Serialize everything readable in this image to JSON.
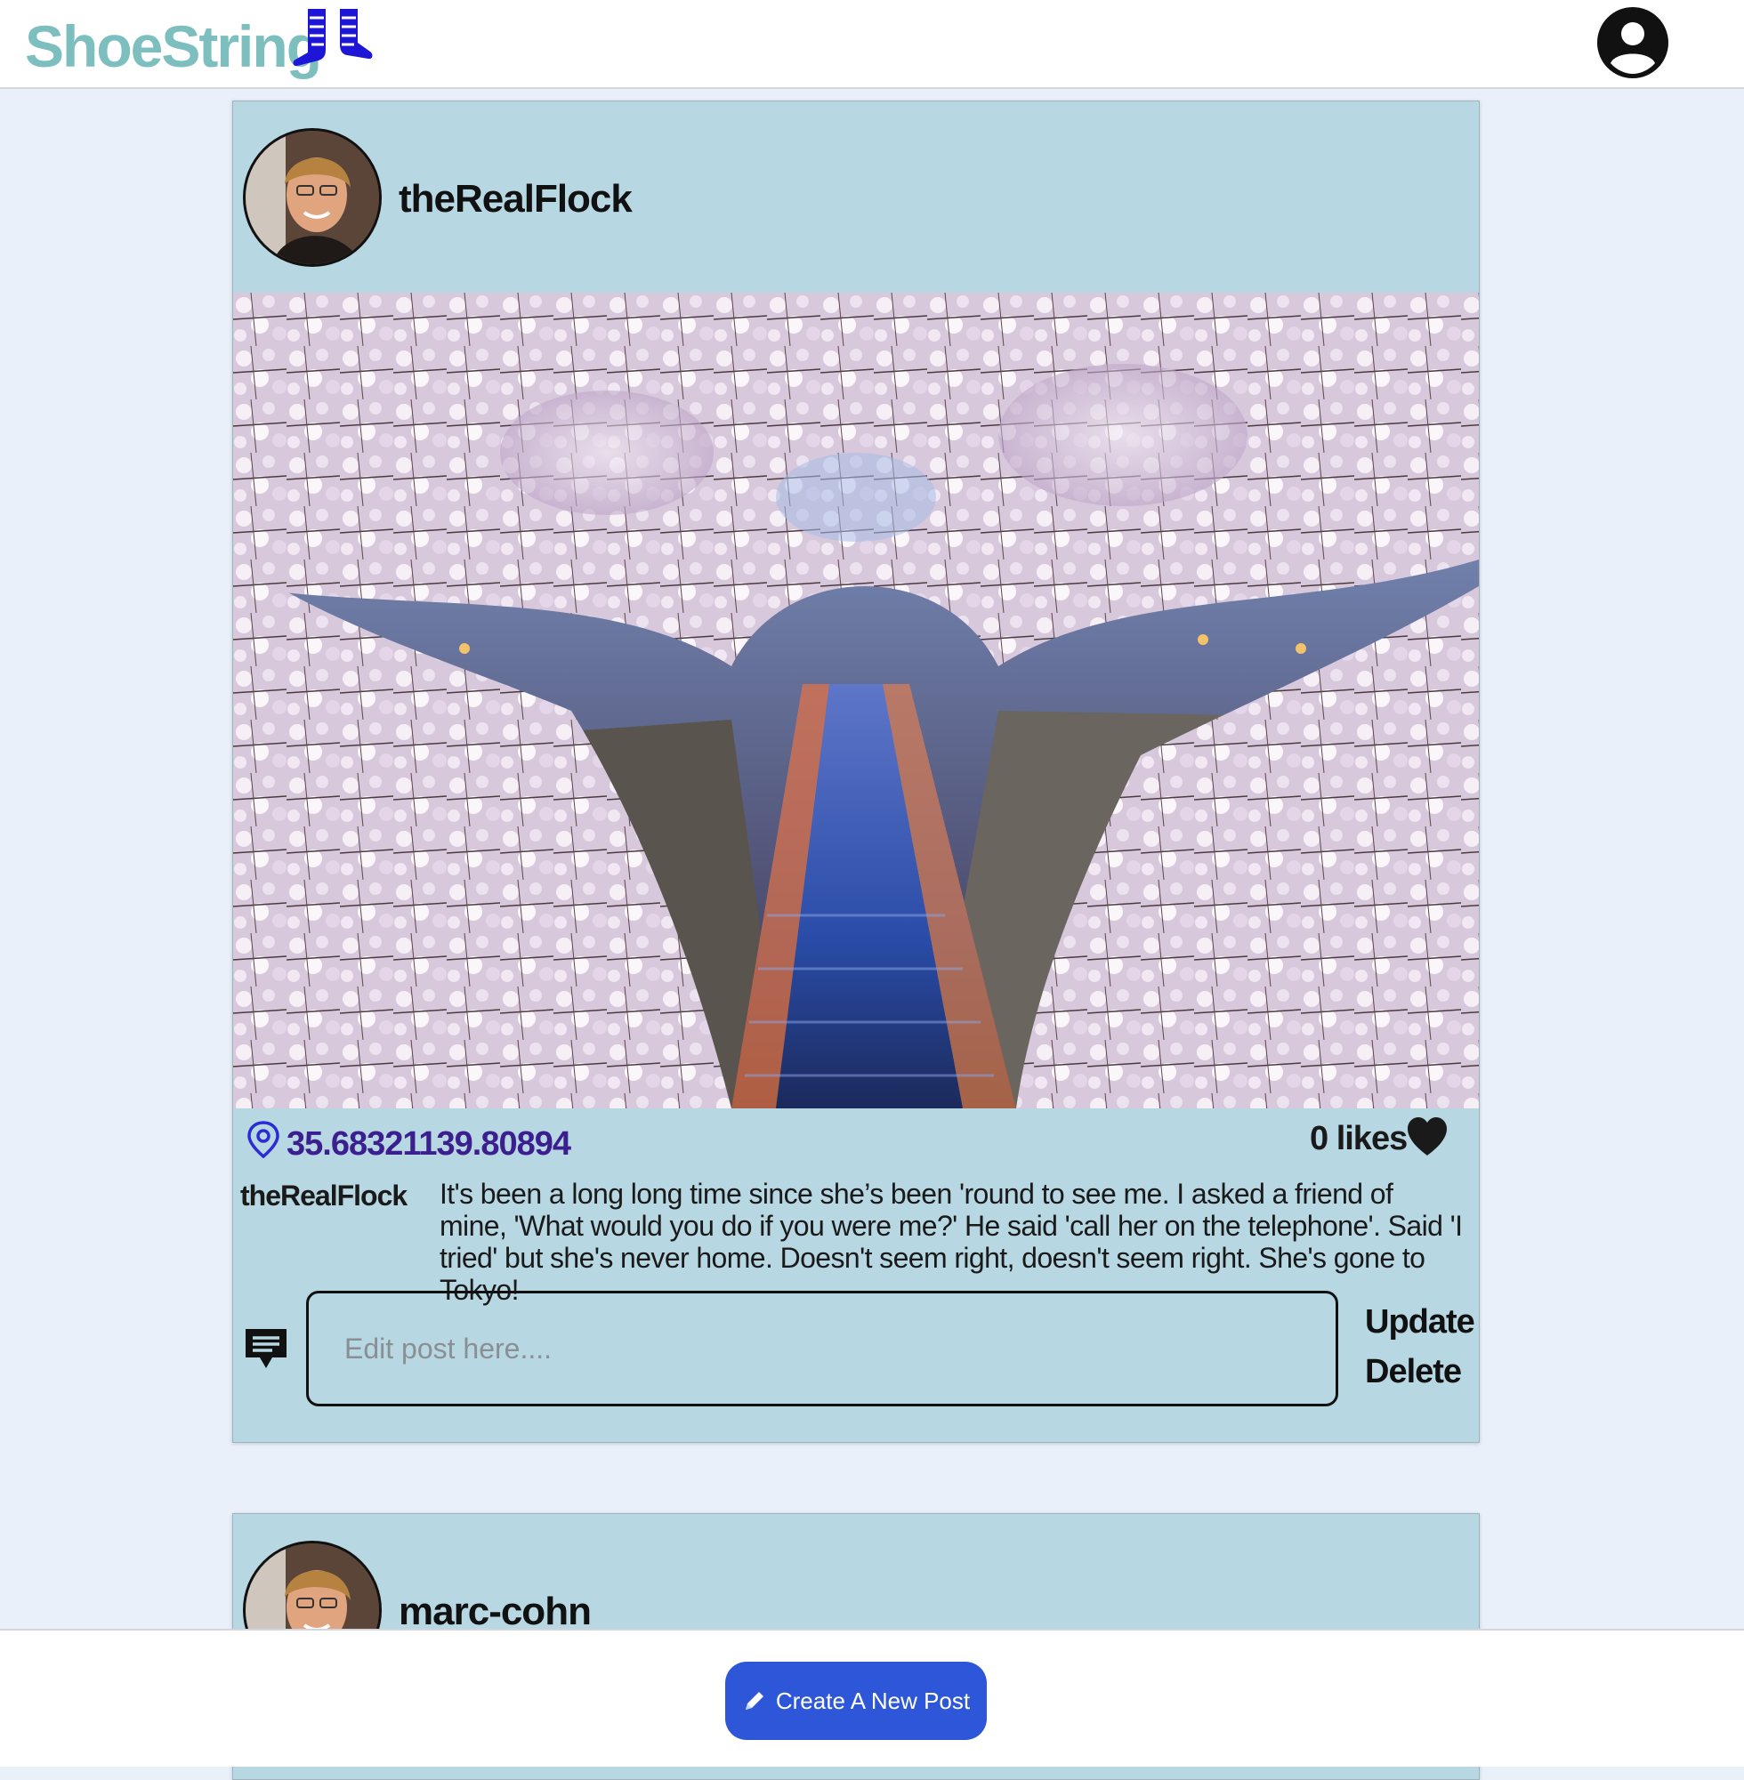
{
  "header": {
    "brand": "ShoeString",
    "logo_icon": "shoelace-boots-icon",
    "profile_icon": "user-circle-icon",
    "brand_color": "#7dbfbe",
    "logo_color": "#1d16d6"
  },
  "posts": [
    {
      "username": "theRealFlock",
      "location": "35.68321139.80894",
      "likes_label": "0 likes",
      "caption_user": "theRealFlock",
      "caption": "It's been a long long time since she’s been 'round to see me. I asked a friend of mine, 'What would you do if you were me?' He said 'call her on the telephone'. Said 'I tried' but she's never home. Doesn't seem right, doesn't seem right. She's gone to Tokyo!",
      "edit_placeholder": "Edit post here....",
      "update_label": "Update",
      "delete_label": "Delete"
    },
    {
      "username": "marc-cohn"
    }
  ],
  "footer": {
    "create_label": "Create A New Post",
    "button_color": "#2d57d8"
  },
  "colors": {
    "page_bg": "#eaf0fa",
    "card_bg": "#b7d7e3",
    "location_text": "#3c1f8f"
  }
}
